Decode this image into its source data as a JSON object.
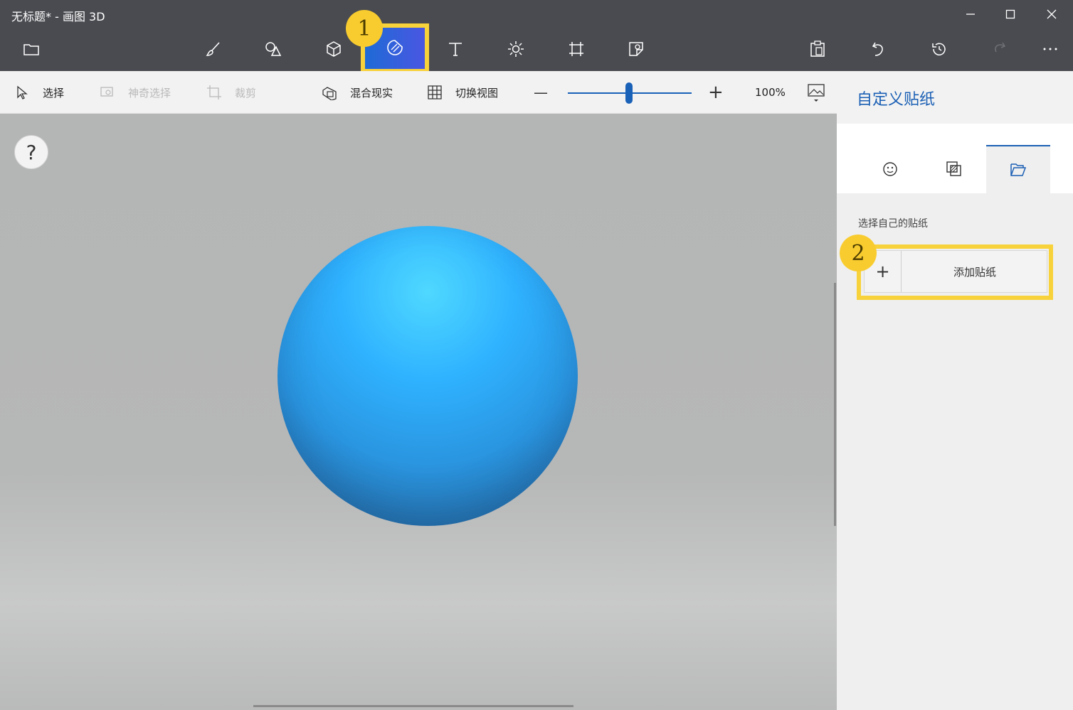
{
  "window": {
    "title": "无标题* - 画图 3D",
    "controls": [
      "minimize",
      "maximize",
      "close"
    ]
  },
  "toolbar": {
    "left_items": [
      {
        "icon": "folder-icon"
      }
    ],
    "tools": [
      {
        "icon": "brush-icon"
      },
      {
        "icon": "2d-shapes-icon"
      },
      {
        "icon": "3d-shapes-icon"
      },
      {
        "icon": "stickers-icon",
        "active": true
      },
      {
        "icon": "text-icon"
      },
      {
        "icon": "effects-icon"
      },
      {
        "icon": "canvas-icon"
      },
      {
        "icon": "3d-library-icon"
      }
    ],
    "right_items": [
      {
        "icon": "paste-icon"
      },
      {
        "icon": "undo-icon"
      },
      {
        "icon": "history-icon"
      },
      {
        "icon": "redo-icon"
      },
      {
        "icon": "more-icon"
      }
    ]
  },
  "subtoolbar": {
    "select_label": "选择",
    "magic_select_label": "神奇选择",
    "crop_label": "裁剪",
    "mixed_reality_label": "混合现实",
    "switch_view_label": "切换视图",
    "zoom_minus": "—",
    "zoom_plus": "+",
    "zoom_value": "100%",
    "zoom_fraction": 0.5
  },
  "canvas": {
    "help_label": "?",
    "sphere_color": "#2fb2ff"
  },
  "panel": {
    "title": "自定义贴纸",
    "tabs": [
      {
        "icon": "sticker-face-icon"
      },
      {
        "icon": "texture-icon"
      },
      {
        "icon": "folder-open-icon",
        "active": true
      }
    ],
    "section_label": "选择自己的贴纸",
    "add_plus": "+",
    "add_label": "添加贴纸"
  },
  "annotations": {
    "badge_1": "1",
    "badge_2": "2",
    "highlight_color": "#f8d23a"
  },
  "colors": {
    "accent": "#1a5fb4",
    "titlebar": "#4a4b50",
    "active_tool": "#3a5fdc"
  }
}
